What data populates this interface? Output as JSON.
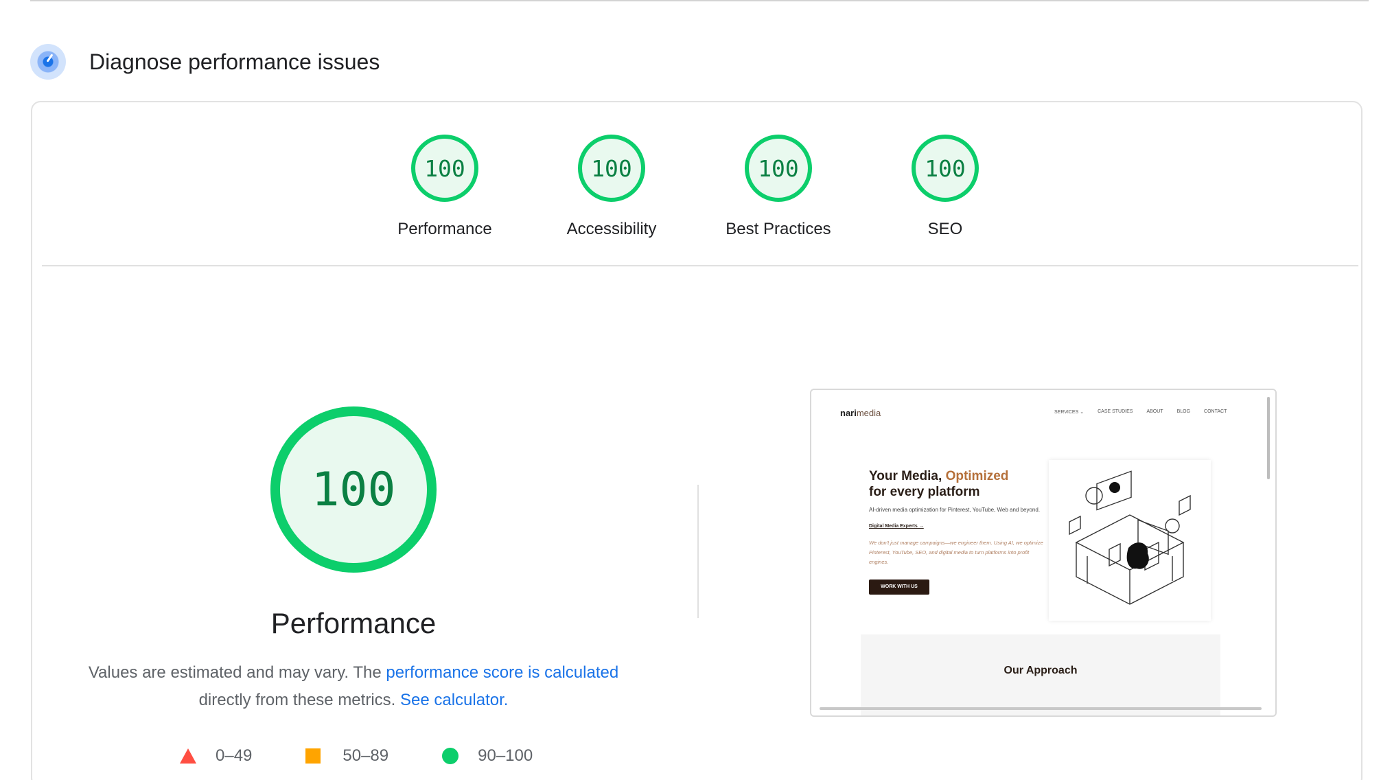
{
  "section": {
    "title": "Diagnose performance issues",
    "icon": "gauge-icon"
  },
  "categories": [
    {
      "label": "Performance",
      "score": "100"
    },
    {
      "label": "Accessibility",
      "score": "100"
    },
    {
      "label": "Best Practices",
      "score": "100"
    },
    {
      "label": "SEO",
      "score": "100"
    }
  ],
  "performance": {
    "score": "100",
    "title": "Performance",
    "desc_prefix": "Values are estimated and may vary. The ",
    "desc_link": "performance score is calculated",
    "desc_mid": " directly from these metrics. ",
    "desc_link2": "See calculator.",
    "legend": [
      {
        "range": "0–49",
        "icon": "triangle-icon",
        "color": "#ff4e42"
      },
      {
        "range": "50–89",
        "icon": "square-icon",
        "color": "#ffa400"
      },
      {
        "range": "90–100",
        "icon": "circle-icon",
        "color": "#0cce6b"
      }
    ]
  },
  "screenshot": {
    "logo_bold": "nari",
    "logo_light": "media",
    "nav": [
      "SERVICES ⌄",
      "CASE STUDIES",
      "ABOUT",
      "BLOG",
      "CONTACT"
    ],
    "headline_1": "Your Media, ",
    "headline_accent": "Optimized",
    "headline_2": "for every platform",
    "subtext": "AI-driven media optimization for Pinterest, YouTube, Web and beyond.",
    "link": "Digital Media Experts →",
    "note": "We don't just manage campaigns—we engineer them. Using AI, we optimize Pinterest, YouTube, SEO, and digital media to turn platforms into profit engines.",
    "button": "WORK WITH US",
    "approach": "Our Approach"
  },
  "colors": {
    "pass": "#0cce6b",
    "pass_bg": "#e9f9ef",
    "pass_text": "#0b8043",
    "link": "#1a73e8"
  }
}
